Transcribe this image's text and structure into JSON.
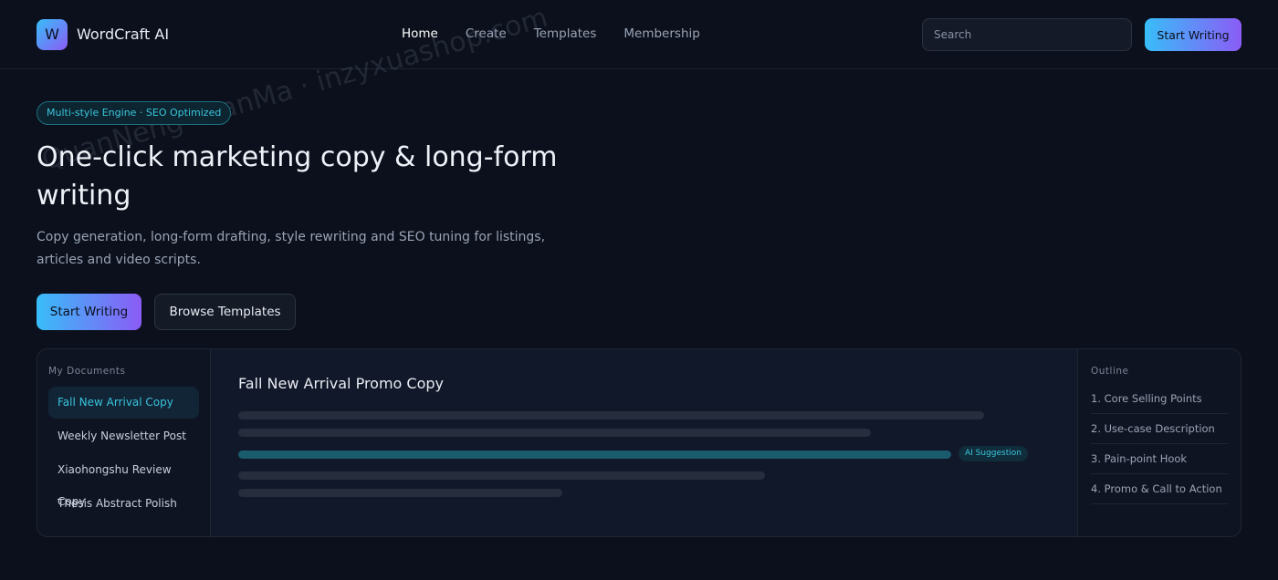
{
  "brand": {
    "logo_letter": "W",
    "name": "WordCraft AI"
  },
  "nav": {
    "items": [
      "Home",
      "Create",
      "Templates",
      "Membership"
    ],
    "active": "Home"
  },
  "search": {
    "placeholder": "Search"
  },
  "header": {
    "cta_label": "Start Writing"
  },
  "watermark": "QuanNeng YuanMa · inzyxuashop.com",
  "hero": {
    "badge": "Multi-style Engine · SEO Optimized",
    "title": "One-click marketing copy & long-form writing",
    "subtitle": "Copy generation, long-form drafting, style rewriting and SEO tuning for listings, articles and video scripts.",
    "primary_label": "Start Writing",
    "secondary_label": "Browse Templates"
  },
  "documents": {
    "title": "My Documents",
    "items": [
      "Fall New Arrival Copy",
      "Weekly Newsletter Post",
      "Xiaohongshu Review Copy",
      "Thesis Abstract Polish"
    ],
    "active_index": 0
  },
  "editor": {
    "doc_title": "Fall New Arrival Promo Copy",
    "ai_tag": "AI Suggestion"
  },
  "outline": {
    "title": "Outline",
    "items": [
      "1. Core Selling Points",
      "2. Use-case Description",
      "3. Pain-point Hook",
      "4. Promo & Call to Action"
    ]
  },
  "colors": {
    "accent_start": "#38bdf8",
    "accent_end": "#8b5cf6",
    "background": "#0b101c",
    "highlight": "#39c3dc"
  }
}
